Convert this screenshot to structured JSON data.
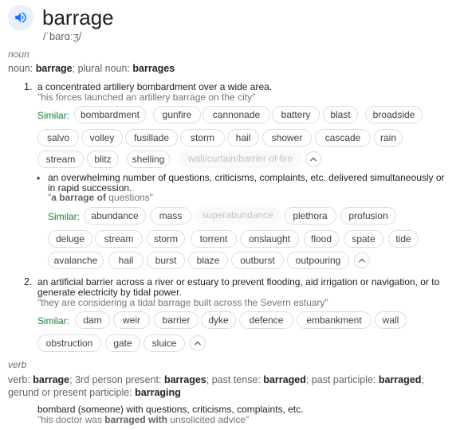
{
  "headword": "barrage",
  "phonetic": "/ˈbarɑːʒ/",
  "noun_section": {
    "pos": "noun",
    "forms_prefix": "noun: ",
    "forms_word": "barrage",
    "forms_mid": "; plural noun: ",
    "forms_plural": "barrages"
  },
  "similar_label": "Similar:",
  "sense1": {
    "number": "1.",
    "definition": "a concentrated artillery bombardment over a wide area.",
    "example": "\"his forces launched an artillery barrage on the city\"",
    "similar": [
      "bombardment",
      "gunfire",
      "cannonade",
      "battery",
      "blast",
      "broadside",
      "salvo",
      "volley",
      "fusillade",
      "storm",
      "hail",
      "shower",
      "cascade",
      "rain",
      "stream",
      "blitz",
      "shelling",
      "wall/curtain/barrier of fire"
    ],
    "muted_index": 17
  },
  "sense1b": {
    "bullet": "•",
    "definition": "an overwhelming number of questions, criticisms, complaints, etc. delivered simultaneously or in rapid succession.",
    "example_open": "\"",
    "example_bold": "a barrage of",
    "example_rest": " questions\"",
    "similar": [
      "abundance",
      "mass",
      "superabundance",
      "plethora",
      "profusion",
      "deluge",
      "stream",
      "storm",
      "torrent",
      "onslaught",
      "flood",
      "spate",
      "tide",
      "avalanche",
      "hail",
      "burst",
      "blaze",
      "outburst",
      "outpouring"
    ],
    "muted_index": 2
  },
  "sense2": {
    "number": "2.",
    "definition": "an artificial barrier across a river or estuary to prevent flooding, aid irrigation or navigation, or to generate electricity by tidal power.",
    "example": "\"they are considering a tidal barrage built across the Severn estuary\"",
    "similar": [
      "dam",
      "weir",
      "barrier",
      "dyke",
      "defence",
      "embankment",
      "wall",
      "obstruction",
      "gate",
      "sluice"
    ]
  },
  "verb_section": {
    "pos": "verb",
    "p1": "verb: ",
    "b1": "barrage",
    "p2": "; 3rd person present: ",
    "b2": "barrages",
    "p3": "; past tense: ",
    "b3": "barraged",
    "p4": "; past participle: ",
    "b4": "barraged",
    "p5": ";",
    "p6": "gerund or present participle: ",
    "b6": "barraging",
    "definition": "bombard (someone) with questions, criticisms, complaints, etc.",
    "example_open": "\"his doctor was ",
    "example_bold": "barraged with",
    "example_rest": " unsolicited advice\""
  },
  "colors": {
    "accent": "#1a73e8",
    "similar_label": "#188038",
    "muted_text": "#70757a"
  },
  "icons": {
    "speaker": "speaker-icon",
    "collapse": "chevron-up-icon"
  }
}
